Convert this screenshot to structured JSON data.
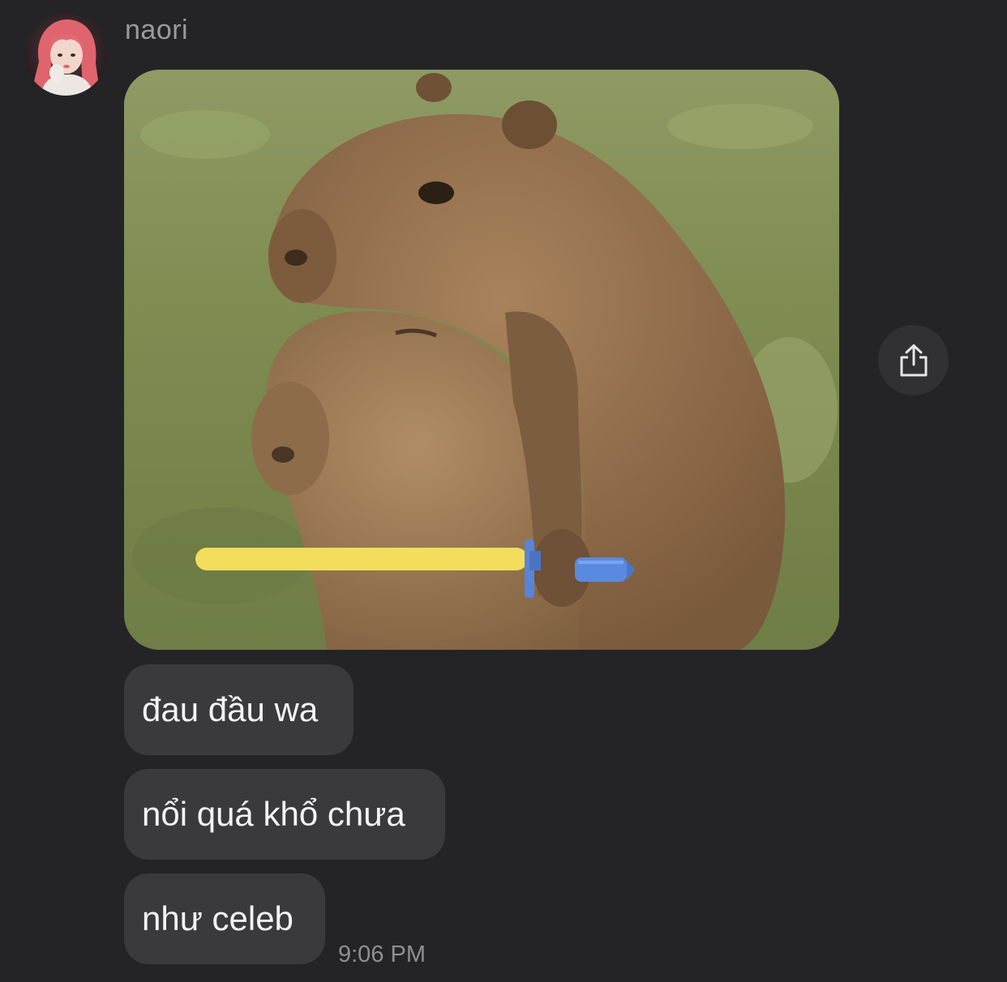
{
  "sender": {
    "name": "naori",
    "avatar_icon": "profile-photo-icon"
  },
  "photo_message": {
    "image_icon": "capybara-hug-photo",
    "share_icon": "share-icon"
  },
  "messages": [
    {
      "text": "đau đầu wa"
    },
    {
      "text": "nổi quá khổ chưa"
    },
    {
      "text": "như celeb"
    }
  ],
  "timestamp": "9:06 PM",
  "colors": {
    "background": "#242427",
    "bubble": "#3a3a3d",
    "share_button": "#313135",
    "sender_text": "#9a9a9f",
    "timestamp_text": "#8e8e93"
  }
}
